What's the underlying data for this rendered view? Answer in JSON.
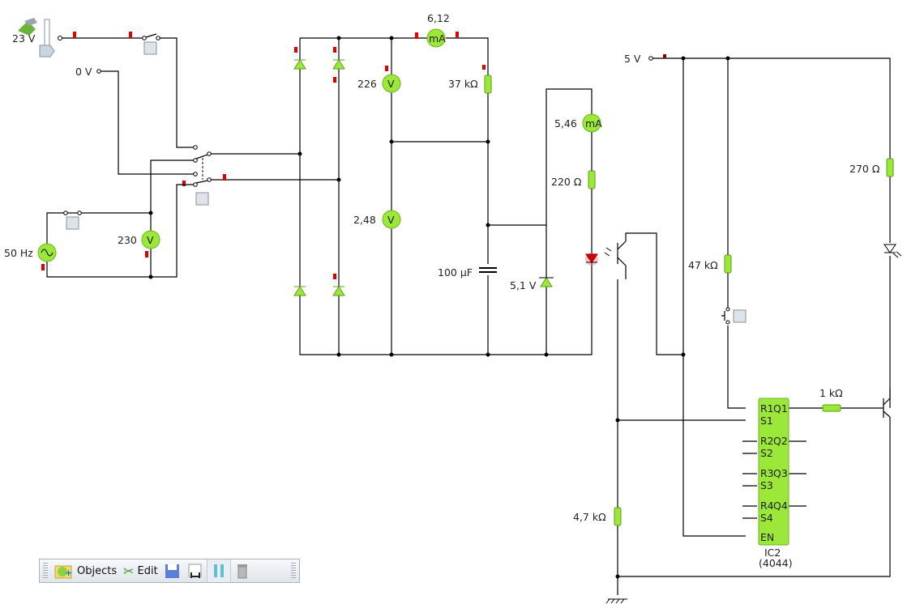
{
  "colors": {
    "component": "#9be83a",
    "marker": "#e00000",
    "wire": "#000000"
  },
  "sources": {
    "dc_voltage": "23 V",
    "zero_voltage": "0 V",
    "ac_frequency": "50 Hz",
    "logic_supply": "5 V"
  },
  "meters": {
    "ac_voltmeter": "230",
    "ammeter_main": "6,12",
    "voltmeter_top": "226",
    "voltmeter_bottom": "2,48",
    "ammeter_led": "5,46",
    "unit_v": "V",
    "unit_ma": "mA"
  },
  "components": {
    "r_37k": "37 kΩ",
    "r_220": "220 Ω",
    "cap": "100 µF",
    "zener": "5,1 V",
    "r_270": "270 Ω",
    "r_47k": "47 kΩ",
    "r_1k": "1 kΩ",
    "r_4k7": "4,7 kΩ"
  },
  "ic": {
    "name": "IC2",
    "type": "(4044)",
    "pins_left": [
      "R1",
      "S1",
      "R2",
      "S2",
      "R3",
      "S3",
      "R4",
      "S4",
      "EN"
    ],
    "pins_right": [
      "Q1",
      "Q2",
      "Q3",
      "Q4"
    ]
  },
  "toolbar": {
    "objects": "Objects",
    "edit": "Edit",
    "icons": [
      "add-objects-icon",
      "scissors-icon",
      "save-icon",
      "save-as-icon",
      "pause-icon",
      "trash-icon"
    ]
  }
}
